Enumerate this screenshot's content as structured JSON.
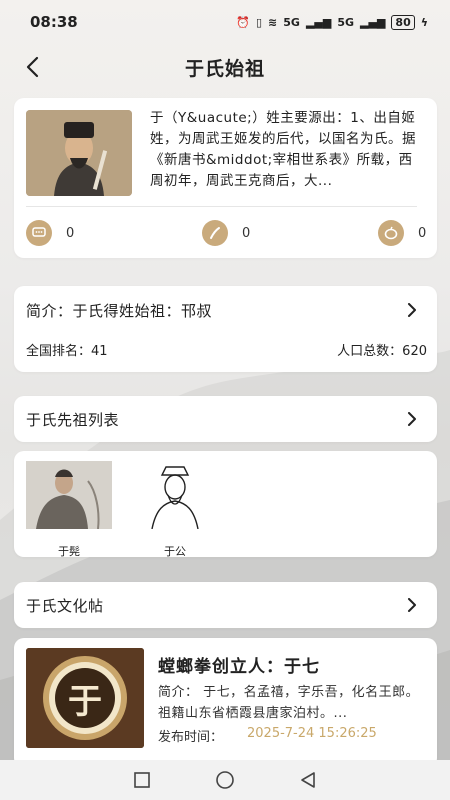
{
  "status_bar": {
    "time": "08:38",
    "network_1": "5G",
    "network_2": "5G",
    "battery": "80"
  },
  "header": {
    "title": "于氏始祖"
  },
  "intro": {
    "text": "于（Y&uacute;）姓主要源出：1、出自姬姓，为周武王姬发的后代，以国名为氏。据《新唐书&middot;宰相世系表》所载，西周初年，周武王克商后，大...",
    "comment_count": "0",
    "like_count": "0",
    "view_count": "0"
  },
  "summary": {
    "title": "简介：于氏得姓始祖：邗叔",
    "rank": "全国排名：41",
    "population": "人口总数：620"
  },
  "ancestors": {
    "title": "于氏先祖列表",
    "items": [
      {
        "name": "于髡"
      },
      {
        "name": "于公"
      }
    ]
  },
  "culture": {
    "title": "于氏文化帖"
  },
  "post": {
    "thumb_char": "于",
    "title": "螳螂拳创立人：于七",
    "summary": "简介：  于七，名孟禧，字乐吾，化名王郎。祖籍山东省栖霞县唐家泊村。...",
    "date_label": "发布时间：",
    "date": "2025-7-24 15:26:25"
  },
  "colors": {
    "accent": "#c9aa7c",
    "date": "#c9a86a"
  }
}
